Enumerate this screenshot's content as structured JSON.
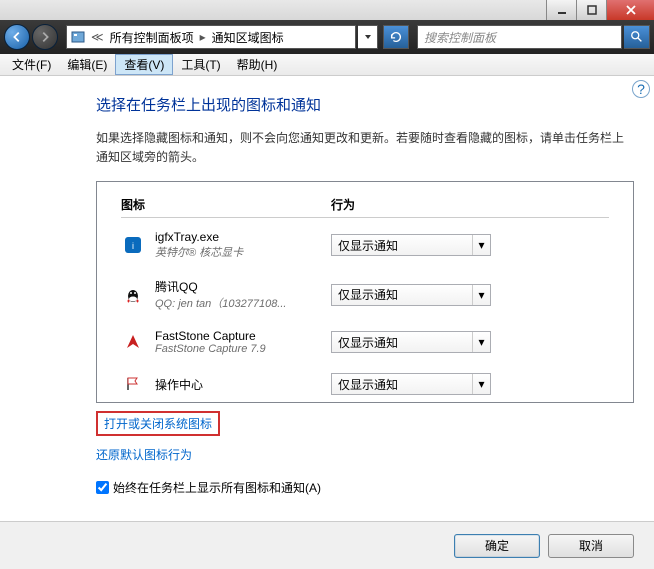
{
  "breadcrumb": {
    "seg1": "所有控制面板项",
    "seg2": "通知区域图标"
  },
  "search": {
    "placeholder": "搜索控制面板"
  },
  "menu": {
    "file": "文件(F)",
    "edit": "编辑(E)",
    "view": "查看(V)",
    "tools": "工具(T)",
    "help": "帮助(H)"
  },
  "page": {
    "title": "选择在任务栏上出现的图标和通知",
    "desc": "如果选择隐藏图标和通知，则不会向您通知更改和更新。若要随时查看隐藏的图标，请单击任务栏上通知区域旁的箭头。",
    "col_icon": "图标",
    "col_behavior": "行为"
  },
  "items": [
    {
      "name": "igfxTray.exe",
      "sub": "英特尔® 核芯显卡",
      "behavior": "仅显示通知",
      "icon": "intel"
    },
    {
      "name": "腾讯QQ",
      "sub": "QQ: jen tan（103277108...",
      "behavior": "仅显示通知",
      "icon": "qq"
    },
    {
      "name": "FastStone Capture",
      "sub": "FastStone Capture 7.9",
      "behavior": "仅显示通知",
      "icon": "fs"
    },
    {
      "name": "操作中心",
      "sub": "",
      "behavior": "仅显示通知",
      "icon": "flag"
    }
  ],
  "links": {
    "system_icons": "打开或关闭系统图标",
    "restore": "还原默认图标行为"
  },
  "checkbox": {
    "label": "始终在任务栏上显示所有图标和通知(A)"
  },
  "buttons": {
    "ok": "确定",
    "cancel": "取消"
  }
}
